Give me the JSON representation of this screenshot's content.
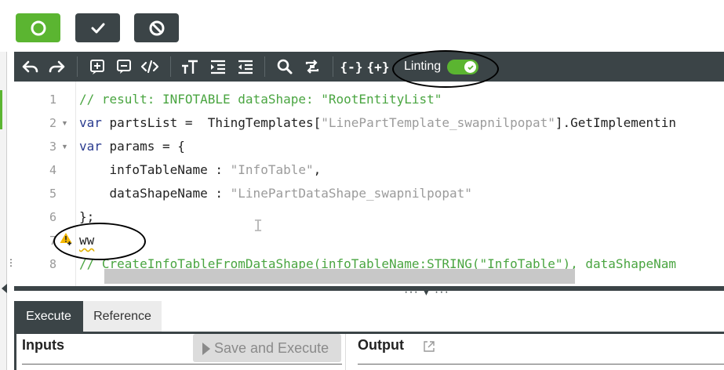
{
  "top_buttons": [
    {
      "name": "circle",
      "color": "#5bb531"
    },
    {
      "name": "check",
      "color": "#3b4447"
    },
    {
      "name": "ban",
      "color": "#3b4447"
    }
  ],
  "toolbar": {
    "linting_label": "Linting",
    "linting_on": true
  },
  "editor": {
    "line_numbers": [
      "1",
      "2",
      "3",
      "4",
      "5",
      "6",
      "7",
      "8"
    ],
    "lines": {
      "l1": "// result: INFOTABLE dataShape: \"RootEntityList\"",
      "l2_kw": "var",
      "l2_a": " partsList =  ThingTemplates[",
      "l2_str": "\"LinePartTemplate_swapnilpopat\"",
      "l2_b": "].GetImplementin",
      "l3_kw": "var",
      "l3_a": " params = {",
      "l4_a": "    infoTableName : ",
      "l4_str": "\"InfoTable\"",
      "l4_b": ",",
      "l5_a": "    dataShapeName : ",
      "l5_str": "\"LinePartDataShape_swapnilpopat\"",
      "l6": "};",
      "l7": "ww",
      "l8": "// CreateInfoTableFromDataShape(infoTableName:STRING(\"InfoTable\"), dataShapeNam"
    }
  },
  "tabs": [
    {
      "label": "Execute",
      "active": true
    },
    {
      "label": "Reference",
      "active": false
    }
  ],
  "inputs": {
    "title": "Inputs",
    "save_execute": "Save and Execute"
  },
  "output": {
    "title": "Output"
  },
  "colors": {
    "toolbar": "#3b4447",
    "green": "#5bb531",
    "comment": "#4aa541",
    "keyword": "#2a3b8f",
    "string": "#9b9b9b"
  }
}
